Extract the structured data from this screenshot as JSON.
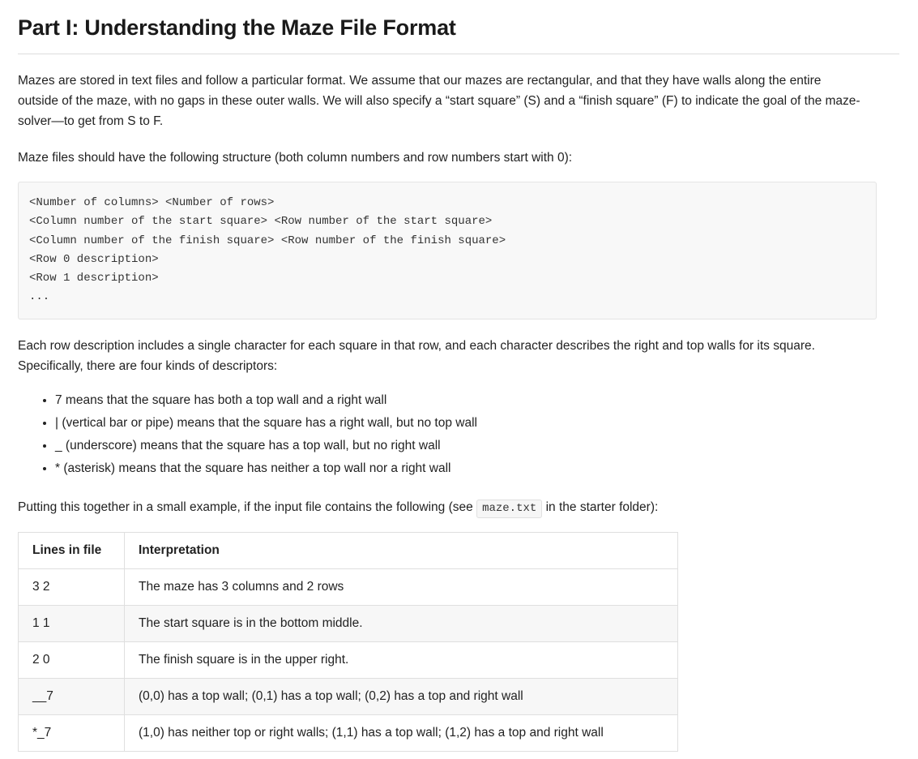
{
  "document": {
    "title": "Part I: Understanding the Maze File Format",
    "paragraphs": {
      "intro": "Mazes are stored in text files and follow a particular format. We assume that our mazes are rectangular, and that they have walls along the entire outside of the maze, with no gaps in these outer walls. We will also specify a “start square” (S) and a “finish square” (F) to indicate the goal of the maze-solver—to get from S to F.",
      "structure_lead": "Maze files should have the following structure (both column numbers and row numbers start with 0):",
      "row_description": "Each row description includes a single character for each square in that row, and each character describes the right and top walls for its square. Specifically, there are four kinds of descriptors:",
      "example_lead_before": "Putting this together in a small example, if the input file contains the following (see",
      "example_inline_code": "maze.txt",
      "example_lead_after": "in the starter folder):"
    },
    "code_block": "<Number of columns> <Number of rows>\n<Column number of the start square> <Row number of the start square>\n<Column number of the finish square> <Row number of the finish square>\n<Row 0 description>\n<Row 1 description>\n...",
    "descriptors": [
      "7 means that the square has both a top wall and a right wall",
      "| (vertical bar or pipe) means that the square has a right wall, but no top wall",
      "_ (underscore) means that the square has a top wall, but no right wall",
      "* (asterisk) means that the square has neither a top wall nor a right wall"
    ],
    "table": {
      "headers": [
        "Lines in file",
        "Interpretation"
      ],
      "rows": [
        {
          "line": "3 2",
          "interpretation": "The maze has 3 columns and 2 rows",
          "striped": false
        },
        {
          "line": "1 1",
          "interpretation": "The start square is in the bottom middle.",
          "striped": true
        },
        {
          "line": "2 0",
          "interpretation": "The finish square is in the upper right.",
          "striped": false
        },
        {
          "line": "__7",
          "interpretation": "(0,0) has a top wall; (0,1) has a top wall; (0,2) has a top and right wall",
          "striped": true
        },
        {
          "line": "*_7",
          "interpretation": "(1,0) has neither top or right walls; (1,1) has a top wall; (1,2) has a top and right wall",
          "striped": false
        }
      ]
    }
  },
  "colors": {
    "text": "#222222",
    "code_background": "#f8f8f8",
    "code_border": "#e4e4e4",
    "table_border": "#dfdfdf",
    "stripe": "#f7f7f7",
    "rule": "#dddddd"
  }
}
